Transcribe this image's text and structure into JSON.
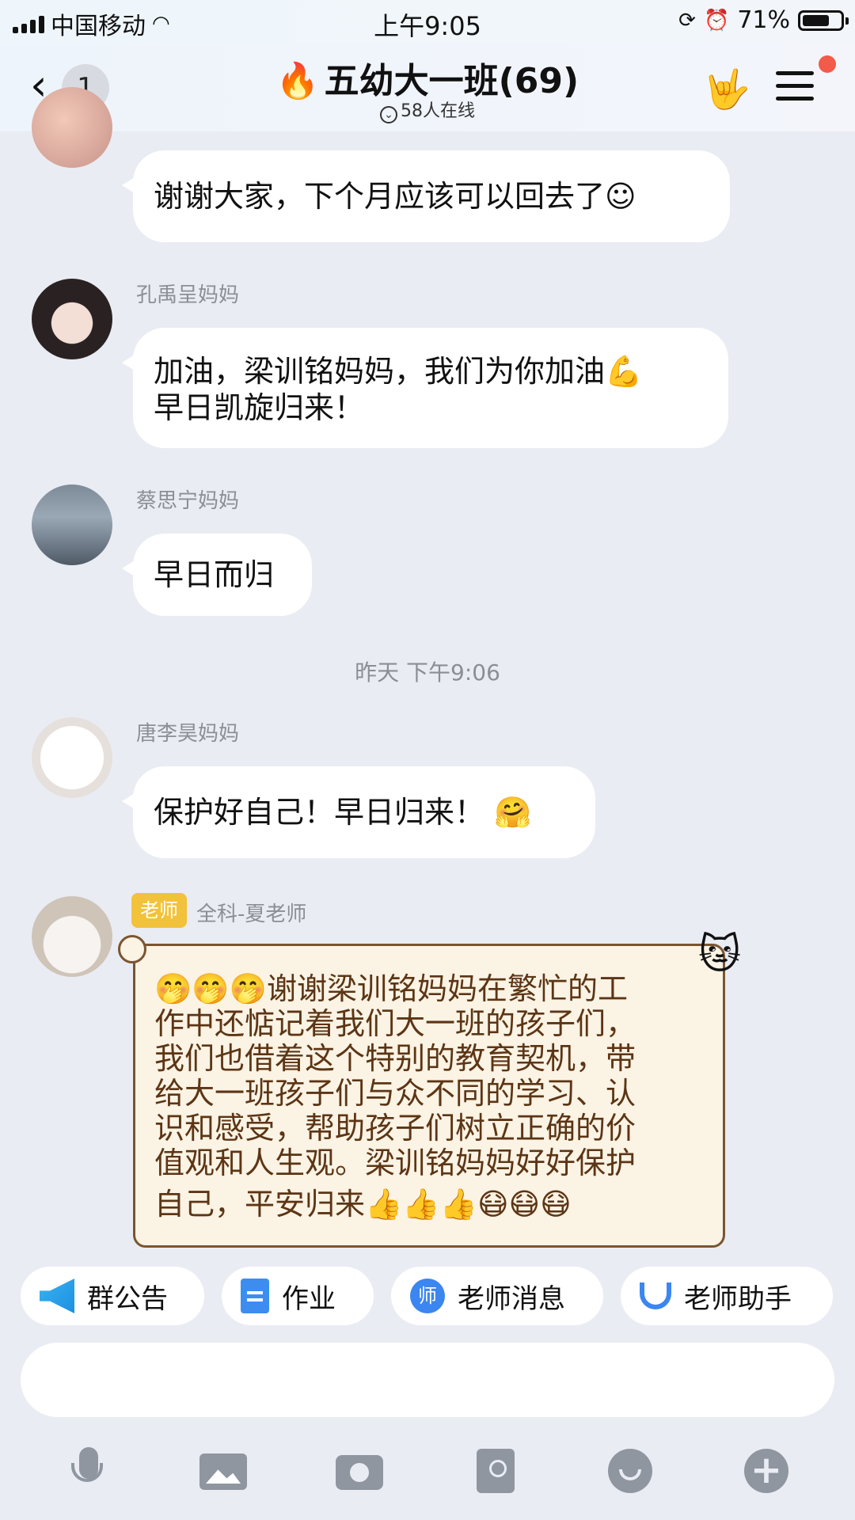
{
  "status_bar": {
    "carrier": "中国移动",
    "time": "上午9:05",
    "battery": "71%",
    "battery_level": 0.71
  },
  "header": {
    "back_count": "1",
    "title": "五幼大一班(69)",
    "online": "58人在线",
    "icons": [
      "back-arrow-icon",
      "rock-hand-icon",
      "menu-icon"
    ]
  },
  "messages": [
    {
      "sender": "",
      "text": "谢谢大家，下个月应该可以回去了☺"
    },
    {
      "sender": "孔禹呈妈妈",
      "text_line1": "加油，梁训铭妈妈，我们为你加油💪",
      "text_line2": "早日凯旋归来！"
    },
    {
      "sender": "蔡思宁妈妈",
      "text": "早日而归"
    },
    {
      "sender": "唐李昊妈妈",
      "text": "保护好自己！早日归来！ 🤗"
    },
    {
      "badge": "老师",
      "sender": "全科-夏老师",
      "lines": [
        "🤭🤭🤭谢谢梁训铭妈妈在繁忙的工",
        "作中还惦记着我们大一班的孩子们，",
        "我们也借着这个特别的教育契机，带",
        "给大一班孩子们与众不同的学习、认",
        "识和感受，帮助孩子们树立正确的价",
        "值观和人生观。梁训铭妈妈好好保护",
        "自己，平安归来👍👍👍😷😷😷"
      ]
    }
  ],
  "timestamp": "昨天 下午9:06",
  "quick_actions": [
    {
      "label": "群公告",
      "icon": "megaphone-icon"
    },
    {
      "label": "作业",
      "icon": "document-icon"
    },
    {
      "label": "老师消息",
      "icon": "teacher-icon"
    },
    {
      "label": "老师助手",
      "icon": "assistant-icon"
    }
  ],
  "input": {
    "placeholder": ""
  },
  "toolbar": [
    "microphone-icon",
    "image-icon",
    "camera-icon",
    "red-packet-icon",
    "emoji-icon",
    "plus-icon"
  ],
  "colors": {
    "teacher_badge": "#f2c23b",
    "notification_dot": "#f25a4a",
    "scroll_border": "#7a5530"
  }
}
